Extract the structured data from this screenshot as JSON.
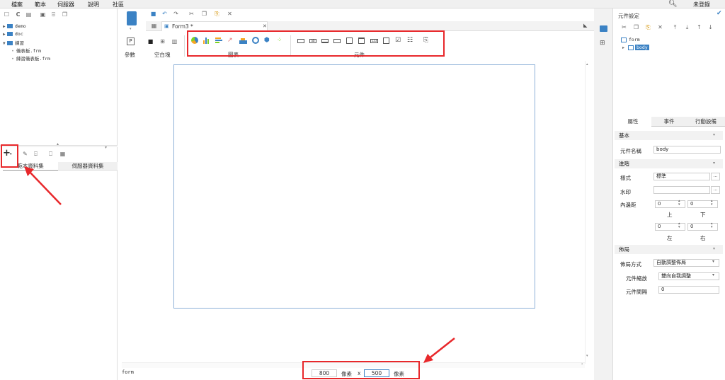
{
  "menubar": {
    "items": [
      "檔案",
      "範本",
      "伺服器",
      "說明",
      "社區"
    ],
    "login_label": "未登錄"
  },
  "left_panel": {
    "tree": [
      {
        "label": "demo",
        "type": "folder"
      },
      {
        "label": "doc",
        "type": "folder"
      },
      {
        "label": "練習",
        "type": "folder"
      },
      {
        "label": "儀表板.frm",
        "type": "file"
      },
      {
        "label": "練習儀表板.frm",
        "type": "file"
      }
    ],
    "add_label": "+",
    "dataset_tabs": [
      "範本資料集",
      "伺服器資料集"
    ]
  },
  "editor": {
    "file_tab": "Form3 *",
    "toolbar_groups": {
      "params": "參數",
      "blank": "空白塊",
      "charts": "圖表",
      "components": "元件"
    },
    "canvas": {
      "width_value": "800",
      "height_value": "500",
      "unit": "像素",
      "times": "x"
    },
    "status_text": "form"
  },
  "right_panel": {
    "title": "元件設定",
    "tree": {
      "root": "form",
      "child": "body"
    },
    "tabs": [
      "屬性",
      "事件",
      "行動設備"
    ],
    "sections": {
      "basic": "基本",
      "advanced": "進階",
      "layout": "佈局"
    },
    "props": {
      "name_label": "元件名稱",
      "name_value": "body",
      "style_label": "樣式",
      "style_value": "標準",
      "watermark_label": "水印",
      "padding_label": "內邊距",
      "pad_top": "0",
      "pad_bottom": "0",
      "pad_left": "0",
      "pad_right": "0",
      "top_label": "上",
      "bottom_label": "下",
      "left_label": "左",
      "right_label": "右",
      "layout_mode_label": "佈局方式",
      "layout_mode_value": "自動調整佈局",
      "scale_label": "元件縮放",
      "scale_value": "雙向自我調整",
      "gap_label": "元件間隔",
      "gap_value": "0"
    }
  },
  "colors": {
    "accent": "#3b82c4",
    "highlight_box": "#e8282b",
    "selection": "#3b82c4"
  }
}
